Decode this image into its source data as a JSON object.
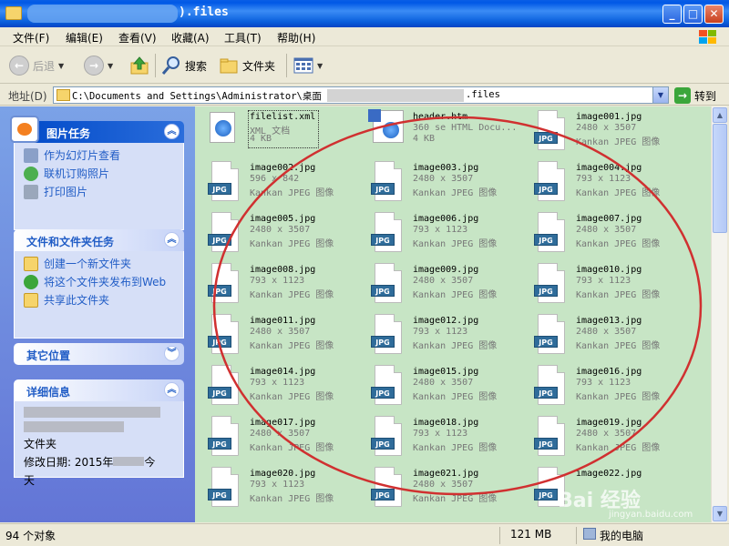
{
  "window": {
    "title": ").files",
    "minimize_label": "_",
    "maximize_label": "□",
    "close_label": "✕"
  },
  "menu": [
    "文件(F)",
    "编辑(E)",
    "查看(V)",
    "收藏(A)",
    "工具(T)",
    "帮助(H)"
  ],
  "toolbar": {
    "back_label": "后退",
    "search_label": "搜索",
    "folders_label": "文件夹"
  },
  "address": {
    "label": "地址(D)",
    "path": "C:\\Documents and Settings\\Administrator\\桌面",
    "suffix": ".files",
    "go_label": "转到"
  },
  "sidebar": {
    "picture_tasks": {
      "title": "图片任务",
      "items": [
        "作为幻灯片查看",
        "联机订购照片",
        "打印图片"
      ]
    },
    "file_tasks": {
      "title": "文件和文件夹任务",
      "items": [
        "创建一个新文件夹",
        "将这个文件夹发布到Web",
        "共享此文件夹"
      ]
    },
    "other_places": {
      "title": "其它位置"
    },
    "details": {
      "title": "详细信息",
      "line_type": "文件夹",
      "line_modified_prefix": "修改日期: 2015年",
      "line_modified_suffix": "今",
      "line_tail": "天"
    }
  },
  "files": [
    {
      "name": "filelist.xml",
      "line2": "XML 文档",
      "line3": "4 KB",
      "type": "xml"
    },
    {
      "name": "header.htm",
      "line2": "360 se HTML Docu...",
      "line3": "4 KB",
      "type": "htm"
    },
    {
      "name": "image001.jpg",
      "line2": "2480 x 3507",
      "line3": "Kankan JPEG 图像",
      "type": "jpg"
    },
    {
      "name": "image002.jpg",
      "line2": "596 x 842",
      "line3": "Kankan JPEG 图像",
      "type": "jpg"
    },
    {
      "name": "image003.jpg",
      "line2": "2480 x 3507",
      "line3": "Kankan JPEG 图像",
      "type": "jpg"
    },
    {
      "name": "image004.jpg",
      "line2": "793 x 1123",
      "line3": "Kankan JPEG 图像",
      "type": "jpg"
    },
    {
      "name": "image005.jpg",
      "line2": "2480 x 3507",
      "line3": "Kankan JPEG 图像",
      "type": "jpg"
    },
    {
      "name": "image006.jpg",
      "line2": "793 x 1123",
      "line3": "Kankan JPEG 图像",
      "type": "jpg"
    },
    {
      "name": "image007.jpg",
      "line2": "2480 x 3507",
      "line3": "Kankan JPEG 图像",
      "type": "jpg"
    },
    {
      "name": "image008.jpg",
      "line2": "793 x 1123",
      "line3": "Kankan JPEG 图像",
      "type": "jpg"
    },
    {
      "name": "image009.jpg",
      "line2": "2480 x 3507",
      "line3": "Kankan JPEG 图像",
      "type": "jpg"
    },
    {
      "name": "image010.jpg",
      "line2": "793 x 1123",
      "line3": "Kankan JPEG 图像",
      "type": "jpg"
    },
    {
      "name": "image011.jpg",
      "line2": "2480 x 3507",
      "line3": "Kankan JPEG 图像",
      "type": "jpg"
    },
    {
      "name": "image012.jpg",
      "line2": "793 x 1123",
      "line3": "Kankan JPEG 图像",
      "type": "jpg"
    },
    {
      "name": "image013.jpg",
      "line2": "2480 x 3507",
      "line3": "Kankan JPEG 图像",
      "type": "jpg"
    },
    {
      "name": "image014.jpg",
      "line2": "793 x 1123",
      "line3": "Kankan JPEG 图像",
      "type": "jpg"
    },
    {
      "name": "image015.jpg",
      "line2": "2480 x 3507",
      "line3": "Kankan JPEG 图像",
      "type": "jpg"
    },
    {
      "name": "image016.jpg",
      "line2": "793 x 1123",
      "line3": "Kankan JPEG 图像",
      "type": "jpg"
    },
    {
      "name": "image017.jpg",
      "line2": "2480 x 3507",
      "line3": "Kankan JPEG 图像",
      "type": "jpg"
    },
    {
      "name": "image018.jpg",
      "line2": "793 x 1123",
      "line3": "Kankan JPEG 图像",
      "type": "jpg"
    },
    {
      "name": "image019.jpg",
      "line2": "2480 x 3507",
      "line3": "Kankan JPEG 图像",
      "type": "jpg"
    },
    {
      "name": "image020.jpg",
      "line2": "793 x 1123",
      "line3": "Kankan JPEG 图像",
      "type": "jpg"
    },
    {
      "name": "image021.jpg",
      "line2": "2480 x 3507",
      "line3": "Kankan JPEG 图像",
      "type": "jpg"
    },
    {
      "name": "image022.jpg",
      "line2": "",
      "line3": "",
      "type": "jpg"
    }
  ],
  "jpg_badge": "JPG",
  "status": {
    "objects": "94 个对象",
    "size": "121 MB",
    "location": "我的电脑"
  },
  "watermark": {
    "main": "Bai 经验",
    "sub": "jingyan.baidu.com"
  },
  "colors": {
    "file_area_bg": "#c7e5c5",
    "annotation": "#d03030",
    "titlebar": "#0a5fdc"
  }
}
